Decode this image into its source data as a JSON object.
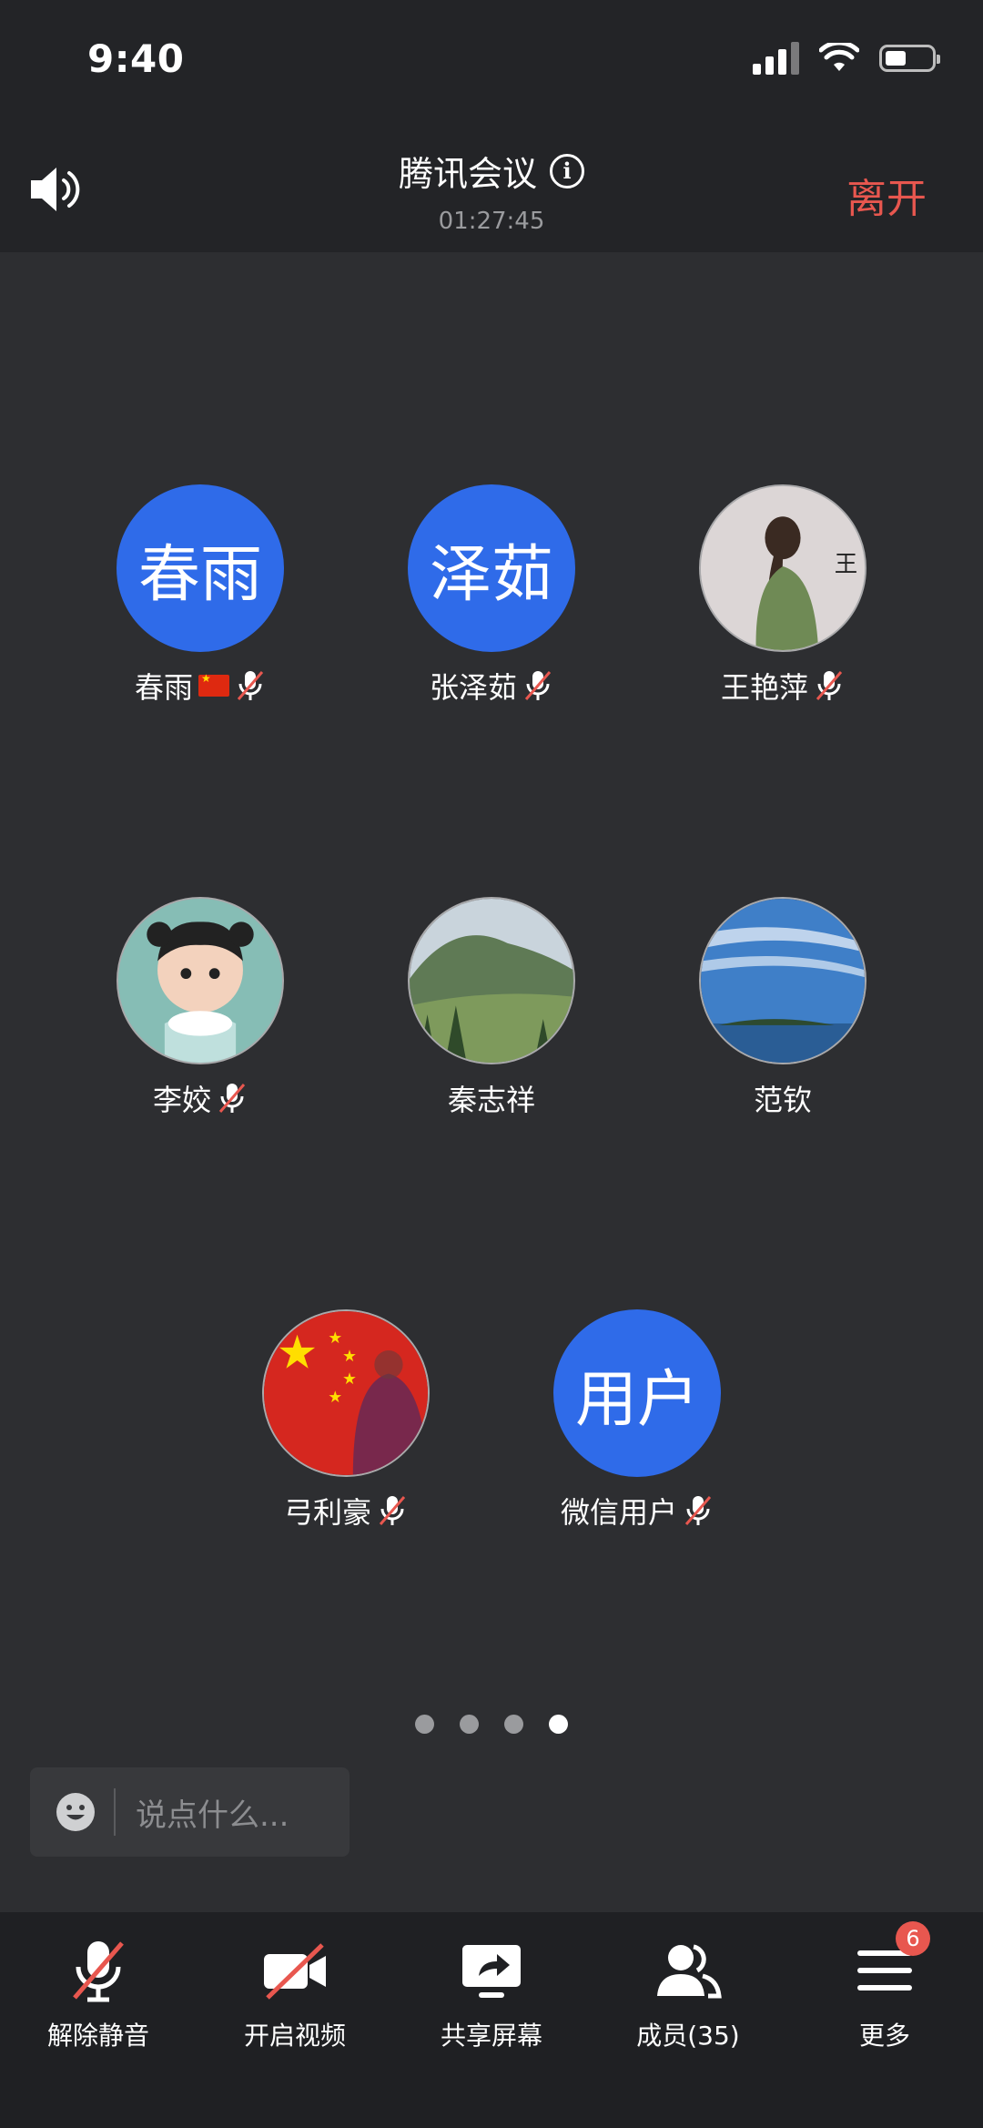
{
  "status_bar": {
    "time": "9:40"
  },
  "header": {
    "title": "腾讯会议",
    "timer": "01:27:45",
    "leave_label": "离开"
  },
  "participants": [
    {
      "name": "春雨",
      "avatar_text": "春雨"
    },
    {
      "name": "张泽茹",
      "avatar_text": "泽茹"
    },
    {
      "name": "王艳萍"
    },
    {
      "name": "李姣"
    },
    {
      "name": "秦志祥"
    },
    {
      "name": "范钦"
    },
    {
      "name": "弓利豪"
    },
    {
      "name": "微信用户",
      "avatar_text": "用户"
    }
  ],
  "page_indicator": {
    "total": 4,
    "current": 4
  },
  "chat": {
    "placeholder": "说点什么..."
  },
  "toolbar": {
    "unmute_label": "解除静音",
    "video_label": "开启视频",
    "share_label": "共享屏幕",
    "members_label": "成员(35)",
    "more_label": "更多",
    "more_badge": "6"
  },
  "colors": {
    "accent_blue": "#2f6be9",
    "leave_red": "#e8574f",
    "background": "#2d2e31",
    "topbar": "#232427",
    "toolbar": "#1f2023"
  }
}
